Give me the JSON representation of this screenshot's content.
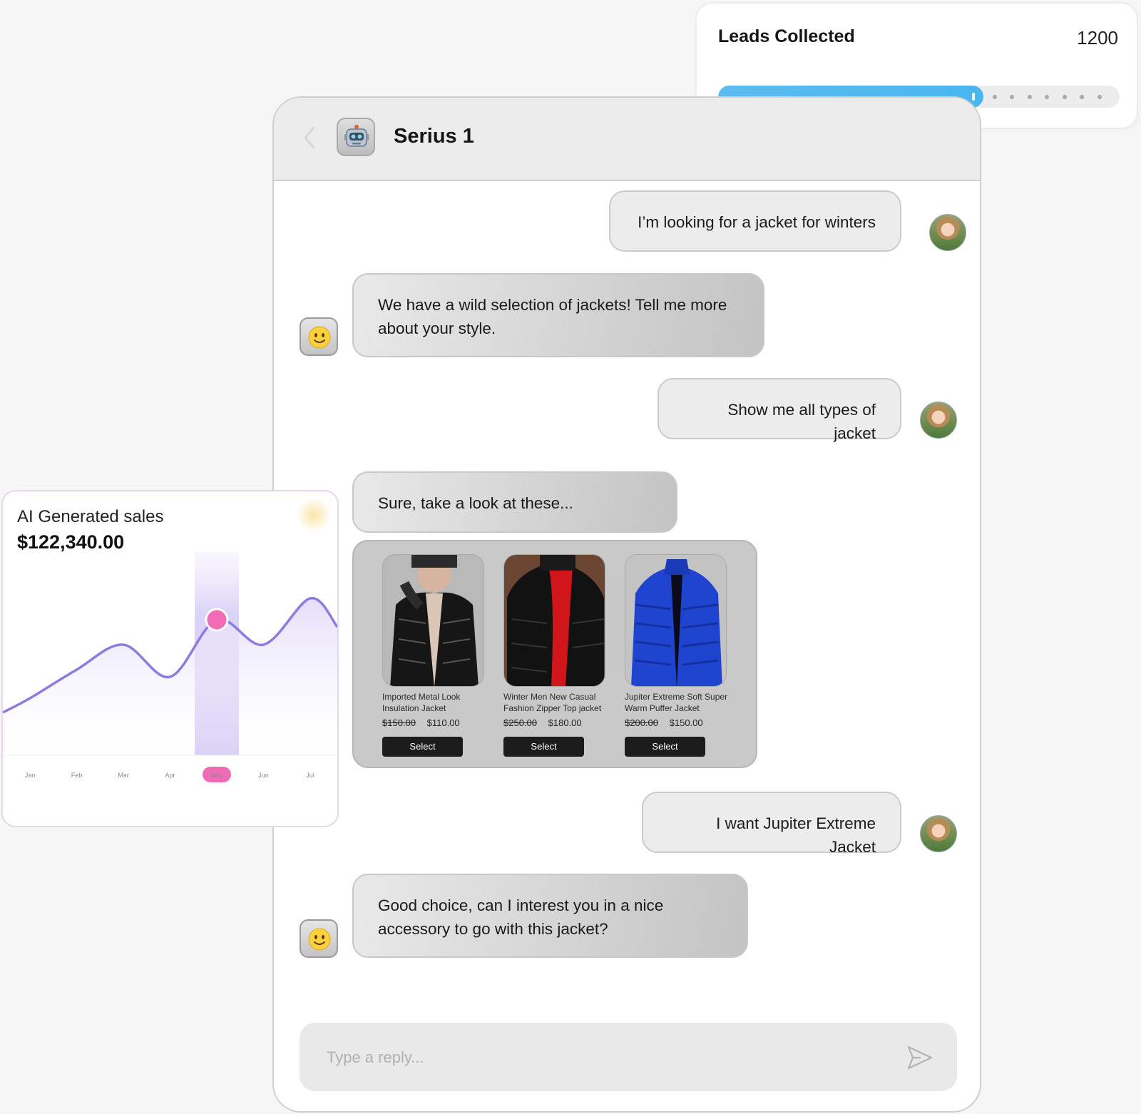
{
  "chat": {
    "title": "Serius 1",
    "messages": [
      {
        "from": "user",
        "text": "I’m looking for a jacket for winters"
      },
      {
        "from": "bot",
        "text": "We have a wild selection of jackets! Tell me more about your style."
      },
      {
        "from": "user",
        "text": "Show me all types of jacket"
      },
      {
        "from": "bot",
        "text": "Sure, take a look at these..."
      },
      {
        "from": "user",
        "text": "I want Jupiter Extreme Jacket"
      },
      {
        "from": "bot",
        "text": "Good choice, can I interest you in a nice accessory to go with this jacket?"
      }
    ],
    "products": [
      {
        "name": "Imported Metal Look Insulation Jacket",
        "old_price": "$150.00",
        "price": "$110.00",
        "button": "Select",
        "image": "black-glossy-puffer-jacket"
      },
      {
        "name": "Winter Men New Casual Fashion Zipper Top jacket",
        "old_price": "$250.00",
        "price": "$180.00",
        "button": "Select",
        "image": "black-red-lined-jacket"
      },
      {
        "name": "Jupiter Extreme Soft Super Warm Puffer Jacket",
        "old_price": "$200.00",
        "price": "$150.00",
        "button": "Select",
        "image": "blue-puffer-jacket"
      }
    ],
    "reply_placeholder": "Type a reply...",
    "icons": {
      "back": "chevron-left-icon",
      "bot": "robot-icon",
      "bot_message": "smiley-emoji-icon",
      "send": "send-icon"
    }
  },
  "leads": {
    "title": "Leads Collected",
    "value": "1200",
    "progress": 0.66,
    "color": "#4ab6ee"
  },
  "sales": {
    "title": "AI Generated sales",
    "amount": "$122,340.00",
    "highlight_color": "#f06bb5",
    "line_color": "#8f7be0"
  },
  "chart_data": {
    "type": "area",
    "categories": [
      "Jan",
      "Feb",
      "Mar",
      "Apr",
      "May",
      "Jun",
      "Jul"
    ],
    "series": [
      {
        "values": [
          0.32,
          0.48,
          0.62,
          0.44,
          0.76,
          0.62,
          0.88
        ]
      }
    ],
    "selected_category": "May",
    "title": "",
    "xlabel": "",
    "ylabel": "",
    "grid": false
  }
}
